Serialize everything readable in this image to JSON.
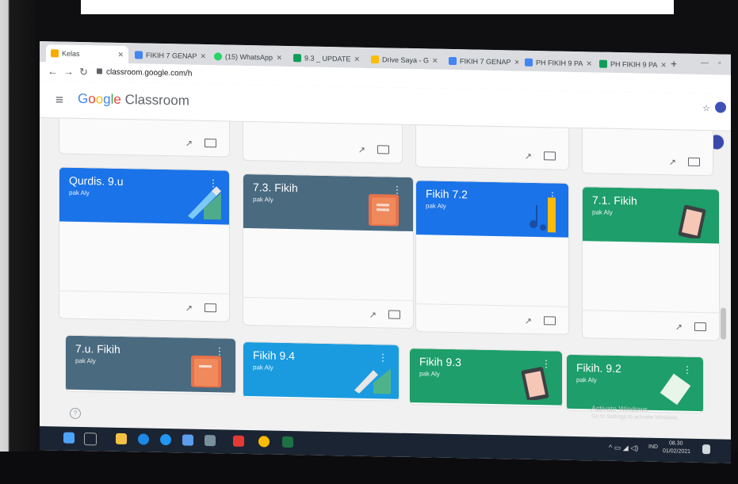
{
  "tabs": [
    {
      "label": "Kelas",
      "color": "#f9ab00"
    },
    {
      "label": "FIKIH 7 GENAP",
      "color": "#4285f4"
    },
    {
      "label": "(15) WhatsApp",
      "color": "#25d366"
    },
    {
      "label": "9.3 _ UPDATE",
      "color": "#0f9d58"
    },
    {
      "label": "Drive Saya - G",
      "color": "#fbbc05"
    },
    {
      "label": "FIKIH 7 GENAP",
      "color": "#4285f4"
    },
    {
      "label": "PH FIKIH 9 PA",
      "color": "#4285f4"
    },
    {
      "label": "PH FIKIH 9 PA",
      "color": "#0f9d58"
    }
  ],
  "address": {
    "url": "classroom.google.com/h"
  },
  "brand": {
    "g1": "G",
    "g2": "o",
    "g3": "o",
    "g4": "g",
    "g5": "l",
    "g6": "e",
    "rest": " Classroom"
  },
  "cards": [
    {
      "title": "Qurdis. 9.u",
      "teacher": "pak Aly",
      "color": "#1a73e8",
      "art": "pencil"
    },
    {
      "title": "7.3. Fikih",
      "teacher": "pak Aly",
      "color": "#4a6a80",
      "art": "book"
    },
    {
      "title": "Fikih 7.2",
      "teacher": "pak Aly",
      "color": "#1a73e8",
      "art": "music"
    },
    {
      "title": "7.1. Fikih",
      "teacher": "pak Aly",
      "color": "#1e9e6a",
      "art": "tablet"
    },
    {
      "title": "7.u. Fikih",
      "teacher": "pak Aly",
      "color": "#4a6a80",
      "art": "book"
    },
    {
      "title": "Fikih 9.4",
      "teacher": "pak Aly",
      "color": "#1a9be0",
      "art": "pencil"
    },
    {
      "title": "Fikih 9.3",
      "teacher": "pak Aly",
      "color": "#1e9e6a",
      "art": "tablet"
    },
    {
      "title": "Fikih. 9.2",
      "teacher": "pak Aly",
      "color": "#1e9e6a",
      "art": "paper"
    }
  ],
  "watermark": {
    "line1": "Activate Windows",
    "line2": "Go to Settings to activate Windows."
  },
  "tray": {
    "lang": "IND",
    "time": "08.30",
    "date": "01/02/2021"
  },
  "help": {
    "glyph": "?"
  }
}
